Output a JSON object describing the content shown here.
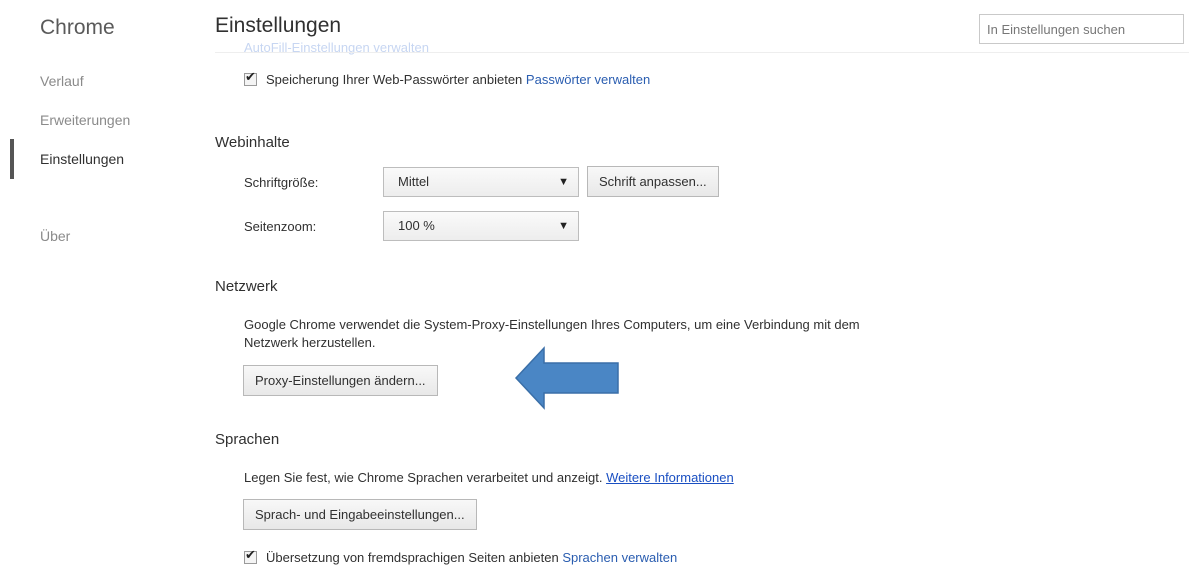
{
  "sidebar": {
    "brand": "Chrome",
    "items": [
      {
        "label": "Verlauf"
      },
      {
        "label": "Erweiterungen"
      },
      {
        "label": "Einstellungen"
      },
      {
        "label": "Über"
      }
    ]
  },
  "header": {
    "title": "Einstellungen",
    "faded_link": "AutoFill-Einstellungen verwalten",
    "search_placeholder": "In Einstellungen suchen"
  },
  "passwords": {
    "checkbox_label": "Speicherung Ihrer Web-Passwörter anbieten",
    "checked": true,
    "link": "Passwörter verwalten"
  },
  "webcontent": {
    "heading": "Webinhalte",
    "font_size_label": "Schriftgröße:",
    "font_size_value": "Mittel",
    "customize_fonts_button": "Schrift anpassen...",
    "zoom_label": "Seitenzoom:",
    "zoom_value": "100 %"
  },
  "network": {
    "heading": "Netzwerk",
    "description": "Google Chrome verwendet die System-Proxy-Einstellungen Ihres Computers, um eine Verbindung mit dem Netzwerk herzustellen.",
    "proxy_button": "Proxy-Einstellungen ändern...",
    "arrow_color": "#4a86c5"
  },
  "languages": {
    "heading": "Sprachen",
    "description": "Legen Sie fest, wie Chrome Sprachen verarbeitet und anzeigt.",
    "more_info_link": "Weitere Informationen",
    "language_button": "Sprach- und Eingabeeinstellungen...",
    "translate_label": "Übersetzung von fremdsprachigen Seiten anbieten",
    "translate_checked": true,
    "manage_link": "Sprachen verwalten"
  }
}
